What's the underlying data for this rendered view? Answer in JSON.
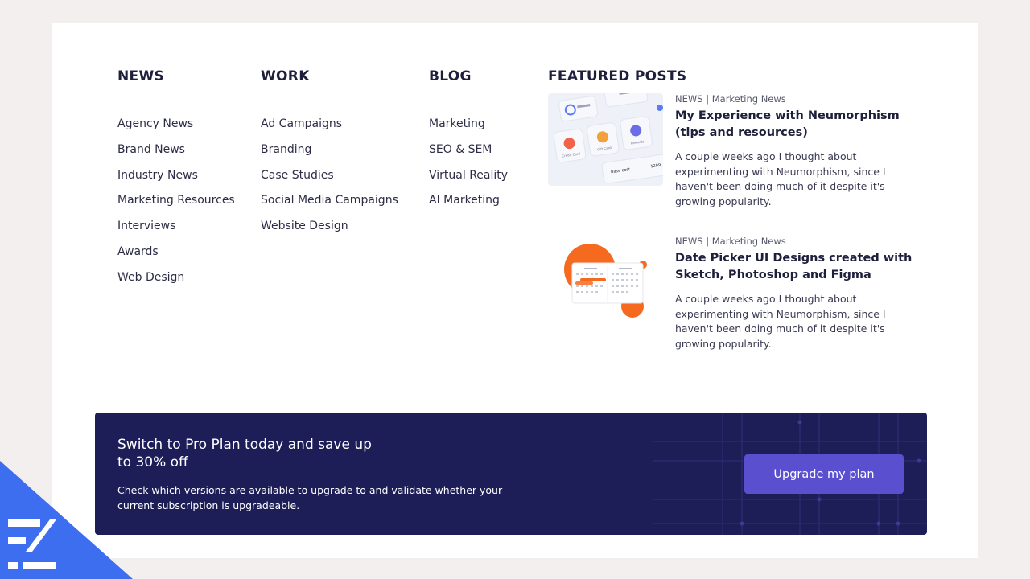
{
  "columns": [
    {
      "heading": "NEWS",
      "items": [
        "Agency News",
        "Brand News",
        "Industry News",
        "Marketing Resources",
        "Interviews",
        "Awards",
        "Web Design"
      ]
    },
    {
      "heading": "WORK",
      "items": [
        "Ad Campaigns",
        "Branding",
        "Case Studies",
        "Social Media Campaigns",
        "Website Design"
      ]
    },
    {
      "heading": "BLOG",
      "items": [
        "Marketing",
        "SEO & SEM",
        "Virtual Reality",
        "AI Marketing"
      ]
    }
  ],
  "featured": {
    "heading": "FEATURED POSTS",
    "posts": [
      {
        "meta": "NEWS | Marketing News",
        "title": "My Experience with Neumorphism (tips and resources)",
        "excerpt": "A couple weeks ago I thought about experimenting with Neumorphism, since I haven't been doing much of it despite it's growing popularity.",
        "thumb_icon": "neumorphism-cards-thumbnail",
        "thumb_labels": {
          "card1": "Credit Card",
          "card2": "Gift Card",
          "card3": "Rewards",
          "base": "Base cost",
          "price": "$299"
        }
      },
      {
        "meta": "NEWS | Marketing News",
        "title": "Date Picker UI Designs created with Sketch, Photoshop and Figma",
        "excerpt": "A couple weeks ago I thought about experimenting with Neumorphism, since I haven't been doing much of it despite it's growing popularity.",
        "thumb_icon": "date-picker-calendar-thumbnail"
      }
    ]
  },
  "banner": {
    "heading": "Switch to Pro Plan today and save up to 30% off",
    "description": "Check which versions are available to upgrade to and validate whether your current subscription is upgradeable.",
    "button_label": "Upgrade my plan"
  },
  "colors": {
    "page_bg": "#f3efee",
    "banner_bg": "#1d1d58",
    "button_bg": "#5a4fcf",
    "accent_orange": "#f56a1f",
    "brand_blue": "#3d6ef0"
  },
  "logo_icon": "brand-logo-icon"
}
